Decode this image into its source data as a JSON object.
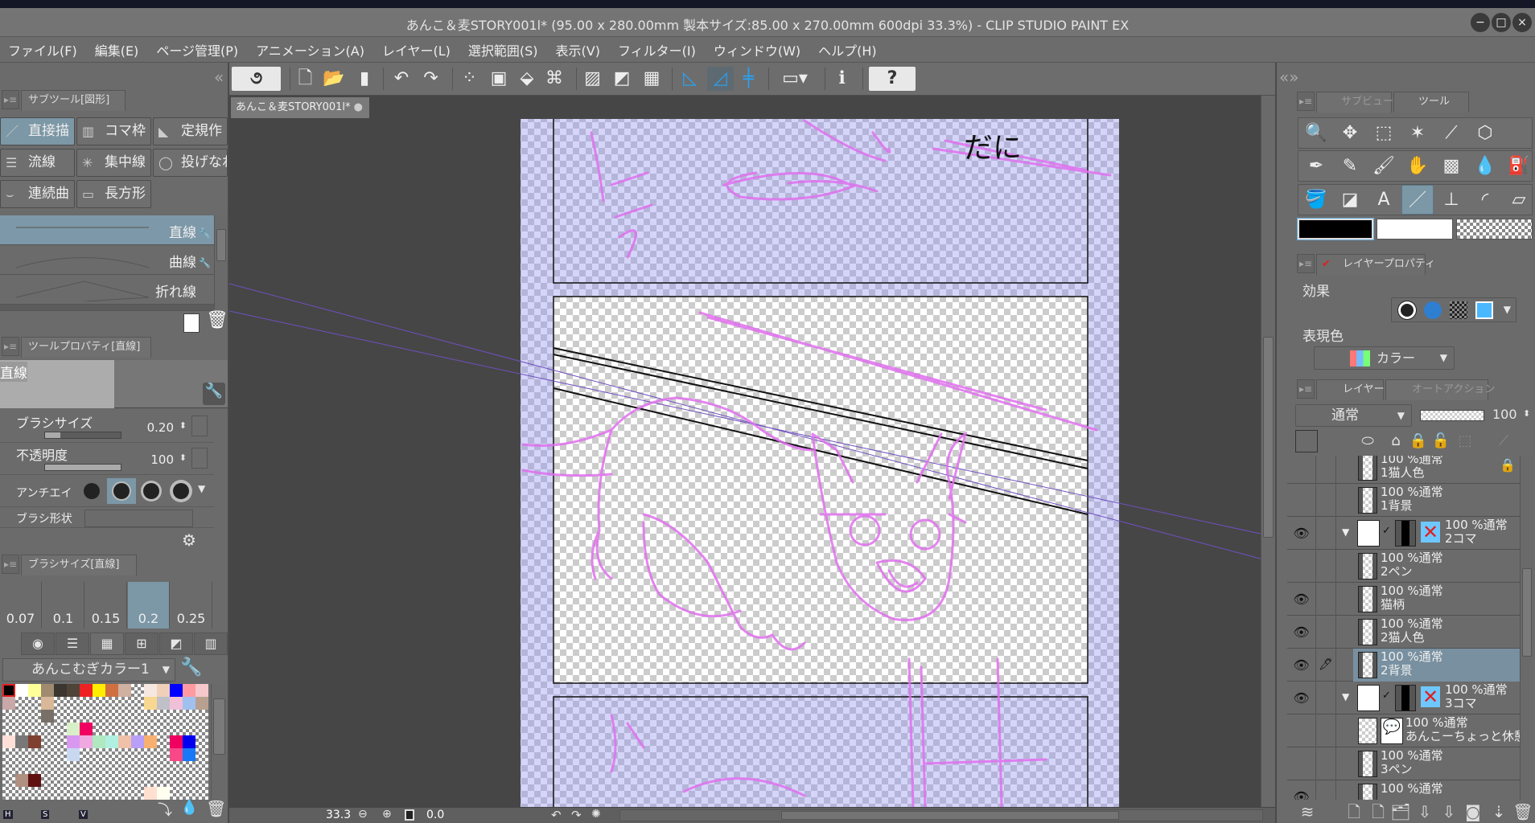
{
  "window": {
    "title": "あんこ＆麦STORY001l* (95.00 x 280.00mm 製本サイズ:85.00 x 270.00mm 600dpi 33.3%)  - CLIP STUDIO PAINT EX",
    "minimize": "−",
    "maximize": "□",
    "close": "×"
  },
  "menu": [
    "ファイル(F)",
    "編集(E)",
    "ページ管理(P)",
    "アニメーション(A)",
    "レイヤー(L)",
    "選択範囲(S)",
    "表示(V)",
    "フィルター(I)",
    "ウィンドウ(W)",
    "ヘルプ(H)"
  ],
  "toolbar": {
    "collapse_left": "«",
    "buttons": [
      {
        "name": "clip-studio-icon",
        "glyph": "૭"
      },
      {
        "name": "new-file-icon",
        "glyph": "🗋"
      },
      {
        "name": "open-folder-icon",
        "glyph": "📂"
      },
      {
        "name": "save-icon",
        "glyph": "▮"
      },
      {
        "name": "undo-icon",
        "glyph": "↶"
      },
      {
        "name": "redo-icon",
        "glyph": "↷"
      },
      {
        "name": "clear-selection-icon",
        "glyph": "⁘"
      },
      {
        "name": "crop-icon",
        "glyph": "▣"
      },
      {
        "name": "fill-selection-icon",
        "glyph": "⬙"
      },
      {
        "name": "transform-icon",
        "glyph": "⌘"
      },
      {
        "name": "show-area-icon",
        "glyph": "▨"
      },
      {
        "name": "hide-area-icon",
        "glyph": "◩"
      },
      {
        "name": "grid-icon",
        "glyph": "▦"
      },
      {
        "name": "snap-to-ruler-icon",
        "glyph": "◺"
      },
      {
        "name": "snap-to-special-ruler-icon",
        "glyph": "◿"
      },
      {
        "name": "snap-to-grid-icon",
        "glyph": "╪"
      },
      {
        "name": "frame-icon",
        "glyph": "▭▾"
      },
      {
        "name": "info-icon",
        "glyph": "ℹ"
      },
      {
        "name": "help-icon",
        "glyph": "?"
      }
    ]
  },
  "subtool_panel": {
    "tab": "サブツール[図形]",
    "groups": [
      {
        "label": "直接描",
        "icon": "／",
        "selected": true
      },
      {
        "label": "コマ枠",
        "icon": "▥",
        "selected": false
      },
      {
        "label": "定規作",
        "icon": "◣",
        "selected": false
      },
      {
        "label": "流線",
        "icon": "☰",
        "selected": false
      },
      {
        "label": "集中線",
        "icon": "✳",
        "selected": false
      },
      {
        "label": "投げなわ",
        "icon": "◯",
        "selected": false
      },
      {
        "label": "連続曲",
        "icon": "⌣",
        "selected": false
      },
      {
        "label": "長方形",
        "icon": "▭",
        "selected": false
      }
    ],
    "items": [
      {
        "label": "直線",
        "selected": true
      },
      {
        "label": "曲線",
        "selected": false
      },
      {
        "label": "折れ線",
        "selected": false
      }
    ]
  },
  "tool_property": {
    "tab": "ツールプロパティ[直線]",
    "preview_label": "直線",
    "brush_size": {
      "label": "ブラシサイズ",
      "value": "0.20",
      "level": 0.2
    },
    "opacity": {
      "label": "不透明度",
      "value": "100",
      "level": 1.0
    },
    "antialias": {
      "label": "アンチエイリアス",
      "selected_index": 1
    },
    "brush_shape": {
      "label": "ブラシ形状"
    }
  },
  "brush_size_panel": {
    "tab": "ブラシサイズ[直線]",
    "sizes": [
      "0.07",
      "0.1",
      "0.15",
      "0.2",
      "0.25"
    ],
    "selected": "0.2"
  },
  "color_set": {
    "name": "あんこむぎカラー1",
    "hsv": [
      "H",
      "S",
      "V"
    ],
    "rows": [
      [
        "#000000",
        "#ffffff",
        "#ffff99",
        "#a08a70",
        "#3c3630",
        "#4e4438",
        "#ee2222",
        "#ffee00",
        "#d07040",
        "#d0b0a0",
        null,
        "#f5e8e0",
        "#f0d0b8",
        "#0000ff",
        "#ff9aa0",
        "#f5c8cc"
      ],
      [
        "#c8a8a8",
        null,
        null,
        "#d8b898",
        null,
        null,
        null,
        null,
        null,
        null,
        null,
        "#f8d890",
        "#c0c0c8",
        "#f0c0d8",
        "#a0c0f0",
        "#b8a090"
      ],
      [
        null,
        null,
        null,
        "#787068",
        null,
        null,
        null,
        null,
        null,
        null,
        null,
        null,
        null,
        null,
        null,
        null
      ],
      [
        null,
        null,
        null,
        null,
        null,
        "#d8f0c8",
        "#f00060",
        null,
        null,
        null,
        null,
        null,
        null,
        null,
        null,
        null
      ],
      [
        "#ffe0d8",
        "#787878",
        "#804030",
        null,
        null,
        "#d898f0",
        "#f0a8e0",
        "#b0e8c0",
        "#b0f0e0",
        "#f0c0a8",
        "#b8a0f8",
        "#f8b070",
        null,
        "#f00060",
        "#0000f0",
        null
      ],
      [
        null,
        null,
        null,
        null,
        null,
        "#c8d8f0",
        null,
        null,
        null,
        null,
        null,
        null,
        null,
        "#f84888",
        "#1878f8",
        null
      ],
      [
        null,
        null,
        null,
        null,
        null,
        null,
        null,
        null,
        null,
        null,
        null,
        null,
        null,
        null,
        null,
        null
      ],
      [
        null,
        "#b09080",
        "#601010",
        null,
        null,
        null,
        null,
        null,
        null,
        null,
        null,
        null,
        null,
        null,
        null,
        null
      ],
      [
        null,
        null,
        null,
        null,
        null,
        null,
        null,
        null,
        null,
        null,
        null,
        "#ffe0d0",
        "#fffff0",
        null,
        null,
        null
      ]
    ]
  },
  "document_tab": "あんこ＆麦STORY001l*",
  "canvas": {
    "text": "だに",
    "sketch_color": "#e070ee",
    "frame_tint": "#c8c8f8"
  },
  "status": {
    "zoom": "33.3",
    "angle": "0.0"
  },
  "right_panel": {
    "tabs": [
      "サブビュー",
      "ツール"
    ],
    "tools": [
      [
        "zoom-icon",
        "🔍"
      ],
      [
        "move-icon",
        "✥"
      ],
      [
        "selection-icon",
        "⬚"
      ],
      [
        "auto-select-icon",
        "✶"
      ],
      [
        "eyedropper-icon",
        "⟋"
      ],
      [
        "operation-icon",
        "⬡"
      ],
      [
        "pen-icon",
        "✒"
      ],
      [
        "pencil-icon",
        "✎"
      ],
      [
        "brush-icon",
        "🖌"
      ],
      [
        "hand-icon",
        "✋"
      ],
      [
        "blend-icon",
        "▩"
      ],
      [
        "airbrush-icon",
        "💧"
      ],
      [
        "decoration-icon",
        "⛽"
      ],
      [
        "fill-icon",
        "🪣"
      ],
      [
        "gradient-icon",
        "◪"
      ],
      [
        "text-icon",
        "A"
      ],
      [
        "figure-icon",
        "／"
      ],
      [
        "frame-border-icon",
        "⊥"
      ],
      [
        "ruler-icon",
        "◜"
      ],
      [
        "eraser-icon",
        "▱"
      ]
    ],
    "selected_tool": "figure-icon",
    "main_color": "#000000",
    "sub_color": "#ffffff",
    "layer_property": {
      "tab": "レイヤープロパティ",
      "effect_label": "効果",
      "color_label": "表現色",
      "color_mode": "カラー"
    },
    "layer_panel": {
      "tabs": [
        "レイヤー",
        "オートアクション"
      ],
      "blend_mode": "通常",
      "opacity": "100"
    },
    "layers": [
      {
        "status": "100 %通常",
        "name": "1猫人色",
        "type": "raster",
        "visible": false,
        "locked": true
      },
      {
        "status": "100 %通常",
        "name": "1背景",
        "type": "raster",
        "visible": false
      },
      {
        "status": "100 %通常",
        "name": "2コマ",
        "type": "folder",
        "visible": true
      },
      {
        "status": "100 %通常",
        "name": "2ペン",
        "type": "raster",
        "visible": false
      },
      {
        "status": "100 %通常",
        "name": "猫柄",
        "type": "raster",
        "visible": true
      },
      {
        "status": "100 %通常",
        "name": "2猫人色",
        "type": "raster",
        "visible": true
      },
      {
        "status": "100 %通常",
        "name": "2背景",
        "type": "raster",
        "visible": true,
        "selected": true,
        "editing": true
      },
      {
        "status": "100 %通常",
        "name": "3コマ",
        "type": "folder",
        "visible": true
      },
      {
        "status": "100 %通常",
        "name": "あんこーちょっと休憩",
        "type": "balloon",
        "visible": false
      },
      {
        "status": "100 %通常",
        "name": "3ペン",
        "type": "raster",
        "visible": false
      },
      {
        "status": "100 %通常",
        "name": "",
        "type": "raster",
        "visible": true
      }
    ]
  }
}
